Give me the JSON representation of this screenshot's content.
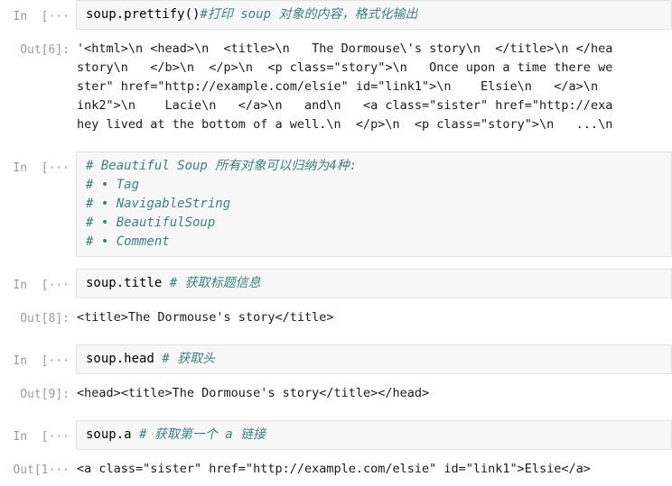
{
  "notebook": {
    "cells": [
      {
        "type": "input",
        "prompt": "In  [···",
        "lines": [
          {
            "code": "soup.prettify()",
            "comment": "#打印 soup 对象的内容，格式化输出"
          }
        ]
      },
      {
        "type": "output",
        "prompt": "Out[6]:",
        "lines": [
          "'<html>\\n <head>\\n  <title>\\n   The Dormouse\\'s story\\n  </title>\\n </hea",
          "story\\n   </b>\\n  </p>\\n  <p class=\"story\">\\n   Once upon a time there we",
          "ster\" href=\"http://example.com/elsie\" id=\"link1\">\\n    Elsie\\n   </a>\\n",
          "ink2\">\\n    Lacie\\n   </a>\\n   and\\n   <a class=\"sister\" href=\"http://exa",
          "hey lived at the bottom of a well.\\n  </p>\\n  <p class=\"story\">\\n   ...\\n"
        ]
      },
      {
        "type": "input",
        "prompt": "In  [···",
        "lines": [
          {
            "code": "",
            "comment": "# Beautiful Soup 所有对象可以归纳为4种:"
          },
          {
            "code": "",
            "comment": "# • Tag"
          },
          {
            "code": "",
            "comment": "# • NavigableString"
          },
          {
            "code": "",
            "comment": "# • BeautifulSoup"
          },
          {
            "code": "",
            "comment": "# • Comment"
          }
        ]
      },
      {
        "type": "input",
        "prompt": "In  [···",
        "lines": [
          {
            "code": "soup.title ",
            "comment": "# 获取标题信息"
          }
        ]
      },
      {
        "type": "output",
        "prompt": "Out[8]:",
        "lines": [
          "<title>The Dormouse's story</title>"
        ]
      },
      {
        "type": "input",
        "prompt": "In  [···",
        "lines": [
          {
            "code": "soup.head ",
            "comment": "# 获取头"
          }
        ]
      },
      {
        "type": "output",
        "prompt": "Out[9]:",
        "lines": [
          "<head><title>The Dormouse's story</title></head>"
        ]
      },
      {
        "type": "input",
        "prompt": "In  [···",
        "lines": [
          {
            "code": "soup.a ",
            "comment": "# 获取第一个 a 链接"
          }
        ]
      },
      {
        "type": "output",
        "prompt": "Out[1···",
        "lines": [
          "<a class=\"sister\" href=\"http://example.com/elsie\" id=\"link1\">Elsie</a>"
        ]
      }
    ]
  },
  "colors": {
    "input_background": "#f7f7f7",
    "input_border": "#e3e3e3",
    "prompt_text": "#999999",
    "comment_text": "#408080",
    "code_text": "#000000",
    "output_text": "#1a1a1a",
    "page_background": "#ffffff"
  }
}
